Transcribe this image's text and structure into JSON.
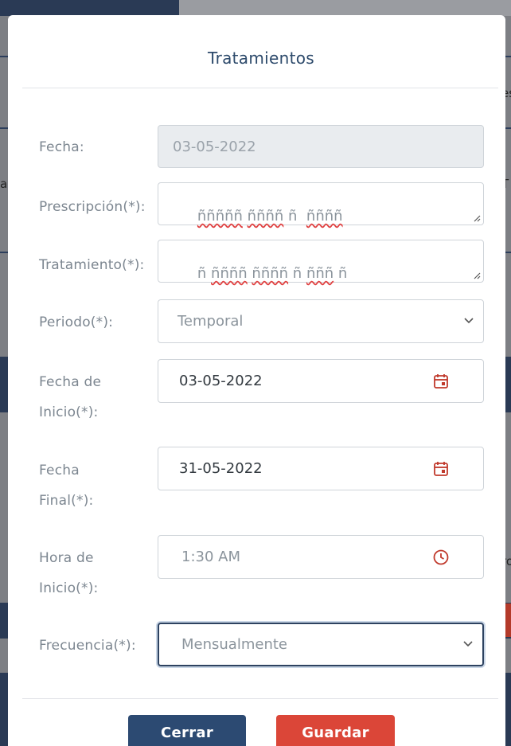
{
  "modal": {
    "title": "Tratamientos",
    "fields": {
      "fecha": {
        "label": "Fecha:",
        "value": "03-05-2022"
      },
      "prescripcion": {
        "label": "Prescripción(*):",
        "words": [
          "ñññññ",
          "ññññ",
          "ñ",
          "ññññ"
        ]
      },
      "tratamiento": {
        "label": "Tratamiento(*):",
        "words": [
          "ñ",
          "ññññ",
          "ññññ",
          "ñ",
          "ñññ",
          "ñ"
        ]
      },
      "periodo": {
        "label": "Periodo(*):",
        "value": "Temporal"
      },
      "fecha_inicio": {
        "label_line1": "Fecha de",
        "label_line2": "Inicio(*):",
        "value": "03-05-2022"
      },
      "fecha_final": {
        "label_line1": "Fecha",
        "label_line2": "Final(*):",
        "value": "31-05-2022"
      },
      "hora_inicio": {
        "label_line1": "Hora de",
        "label_line2": "Inicio(*):",
        "value": "1:30 AM"
      },
      "frecuencia": {
        "label": "Frecuencia(*):",
        "value": "Mensualmente"
      }
    },
    "buttons": {
      "close": "Cerrar",
      "save": "Guardar"
    }
  },
  "background": {
    "left_fragment": "a",
    "right_fragment_1": "es",
    "right_fragment_2": "T",
    "right_fragment_3": "ro"
  },
  "colors": {
    "primary": "#2c4a72",
    "danger": "#db4638",
    "icon": "#c0392b",
    "label": "#7c8690"
  },
  "icons": [
    "calendar-icon",
    "calendar-icon",
    "clock-icon",
    "chevron-down-icon",
    "chevron-down-icon"
  ]
}
